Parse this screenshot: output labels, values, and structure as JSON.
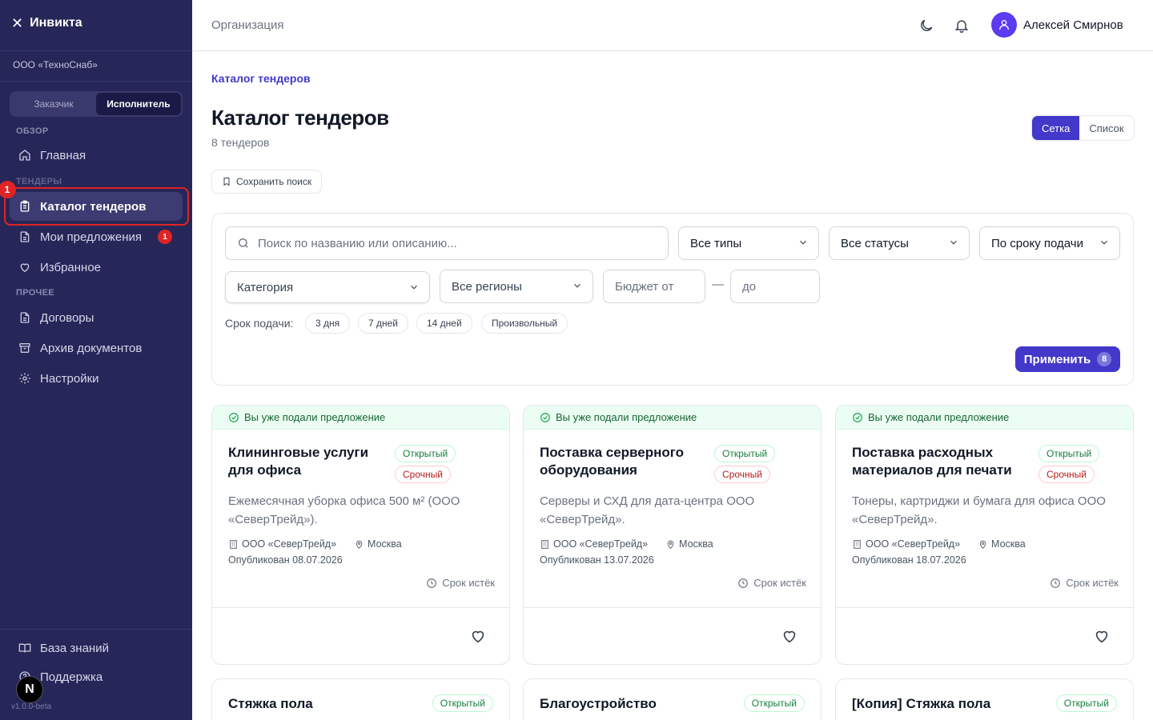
{
  "app": {
    "brand": "Инвикта",
    "org": "ООО «ТехноСнаб»",
    "version": "v1.0.0-beta"
  },
  "roles": {
    "customer": "Заказчик",
    "executor": "Исполнитель",
    "active": "executor"
  },
  "sidebar": {
    "sections": {
      "overview": "ОБЗОР",
      "tenders": "ТЕНДЕРЫ",
      "other": "ПРОЧЕЕ"
    },
    "items": [
      {
        "label": "Главная",
        "icon": "home-icon"
      },
      {
        "label": "Каталог тендеров",
        "icon": "clipboard-icon",
        "active": true
      },
      {
        "label": "Мои предложения",
        "icon": "document-icon",
        "badge": "1"
      },
      {
        "label": "Избранное",
        "icon": "heart-icon"
      },
      {
        "label": "Договоры",
        "icon": "document-icon"
      },
      {
        "label": "Архив документов",
        "icon": "archive-icon"
      },
      {
        "label": "Настройки",
        "icon": "gear-icon"
      }
    ],
    "bottom": [
      {
        "label": "База знаний",
        "icon": "book-icon"
      },
      {
        "label": "Поддержка",
        "icon": "help-icon"
      }
    ],
    "highlight_number": "1",
    "next_badge": "N"
  },
  "header": {
    "crumb": "Организация",
    "user_name": "Алексей Смирнов"
  },
  "page": {
    "breadcrumb": "Каталог тендеров",
    "title": "Каталог тендеров",
    "count": "8 тендеров",
    "view": {
      "grid": "Сетка",
      "list": "Список",
      "active": "grid"
    },
    "save_search": "Сохранить поиск"
  },
  "filters": {
    "search_placeholder": "Поиск по названию или описанию...",
    "type": "Все типы",
    "status": "Все статусы",
    "sort": "По сроку подачи",
    "category": "Категория",
    "region": "Все регионы",
    "budget_from_placeholder": "Бюджет от",
    "budget_to_placeholder": "до",
    "budget_dash": "—",
    "deadline_label": "Срок подачи:",
    "deadline_chips": [
      "3 дня",
      "7 дней",
      "14 дней",
      "Произвольный"
    ],
    "apply_label": "Применить",
    "apply_count": "8"
  },
  "cards": [
    {
      "submitted": "Вы уже подали предложение",
      "title": "Клининговые услуги для офиса",
      "tags": [
        "Открытый",
        "Срочный"
      ],
      "description": "Ежемесячная уборка офиса 500 м² (ООО «СеверТрейд»).",
      "company": "ООО «СеверТрейд»",
      "city": "Москва",
      "published": "Опубликован 08.07.2026",
      "expires": "Срок истёк"
    },
    {
      "submitted": "Вы уже подали предложение",
      "title": "Поставка серверного оборудования",
      "tags": [
        "Открытый",
        "Срочный"
      ],
      "description": "Серверы и СХД для дата-центра ООО «СеверТрейд».",
      "company": "ООО «СеверТрейд»",
      "city": "Москва",
      "published": "Опубликован 13.07.2026",
      "expires": "Срок истёк"
    },
    {
      "submitted": "Вы уже подали предложение",
      "title": "Поставка расходных материалов для печати",
      "tags": [
        "Открытый",
        "Срочный"
      ],
      "description": "Тонеры, картриджи и бумага для офиса ООО «СеверТрейд».",
      "company": "ООО «СеверТрейд»",
      "city": "Москва",
      "published": "Опубликован 18.07.2026",
      "expires": "Срок истёк"
    }
  ],
  "cards_row2": [
    {
      "title": "Стяжка пола",
      "tag": "Открытый"
    },
    {
      "title": "Благоустройство",
      "tag": "Открытый"
    },
    {
      "title": "[Копия] Стяжка пола",
      "tag": "Открытый"
    }
  ],
  "colors": {
    "sidebar_bg": "#272659",
    "accent": "#4338ca",
    "badge_red": "#e02424",
    "success": "#15803d"
  }
}
